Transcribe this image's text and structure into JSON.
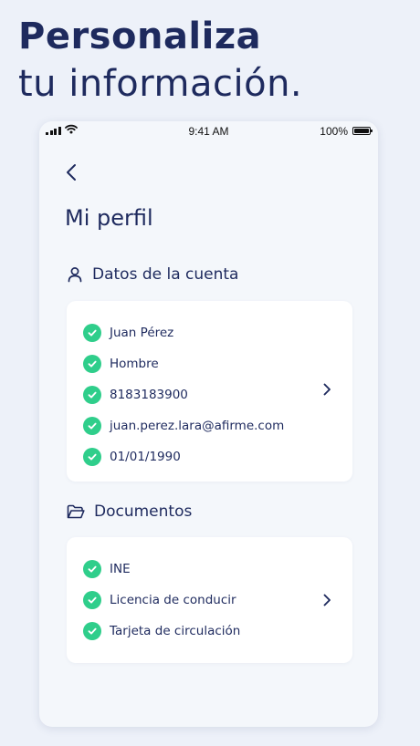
{
  "headline": {
    "line1": "Personaliza",
    "line2": "tu información."
  },
  "statusbar": {
    "time": "9:41 AM",
    "battery": "100%"
  },
  "screen": {
    "title": "Mi perfil",
    "account": {
      "heading": "Datos de la cuenta",
      "icon": "user-icon",
      "items": [
        "Juan Pérez",
        "Hombre",
        "8183183900",
        "juan.perez.lara@afirme.com",
        "01/01/1990"
      ]
    },
    "documents": {
      "heading": "Documentos",
      "icon": "folder-icon",
      "items": [
        "INE",
        "Licencia de conducir",
        "Tarjeta de circulación"
      ]
    }
  },
  "colors": {
    "primary": "#1e2a5e",
    "check": "#2fce8b",
    "background": "#edf1f9",
    "card": "#ffffff"
  }
}
